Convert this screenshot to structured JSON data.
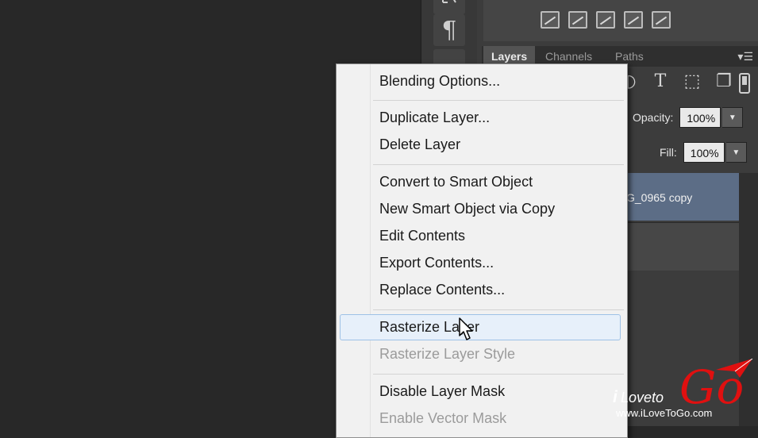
{
  "tool_strip": {
    "paragraph_glyph": "¶"
  },
  "layers_panel": {
    "tabs": [
      {
        "label": "Layers",
        "active": true
      },
      {
        "label": "Channels",
        "active": false
      },
      {
        "label": "Paths",
        "active": false
      }
    ],
    "opacity": {
      "label": "Opacity:",
      "value": "100%"
    },
    "fill": {
      "label": "Fill:",
      "value": "100%"
    },
    "selected_layer_name": "G_0965 copy",
    "selected_color": "#5c6d86"
  },
  "context_menu": {
    "items": [
      {
        "label": "Blending Options...",
        "disabled": false
      },
      {
        "label": "Duplicate Layer...",
        "disabled": false
      },
      {
        "label": "Delete Layer",
        "disabled": false
      },
      {
        "label": "Convert to Smart Object",
        "disabled": false
      },
      {
        "label": "New Smart Object via Copy",
        "disabled": false
      },
      {
        "label": "Edit Contents",
        "disabled": false
      },
      {
        "label": "Export Contents...",
        "disabled": false
      },
      {
        "label": "Replace Contents...",
        "disabled": false
      },
      {
        "label": "Rasterize Layer",
        "disabled": false,
        "hovered": true
      },
      {
        "label": "Rasterize Layer Style",
        "disabled": true
      },
      {
        "label": "Disable Layer Mask",
        "disabled": false
      },
      {
        "label": "Enable Vector Mask",
        "disabled": true
      }
    ],
    "highlight_color": "#f4f12a"
  },
  "watermark": {
    "brand_i": "i",
    "brand_love": "Loveto",
    "brand_go": "Go",
    "url": "www.iLoveToGo.com",
    "accent_color": "#e01010"
  }
}
